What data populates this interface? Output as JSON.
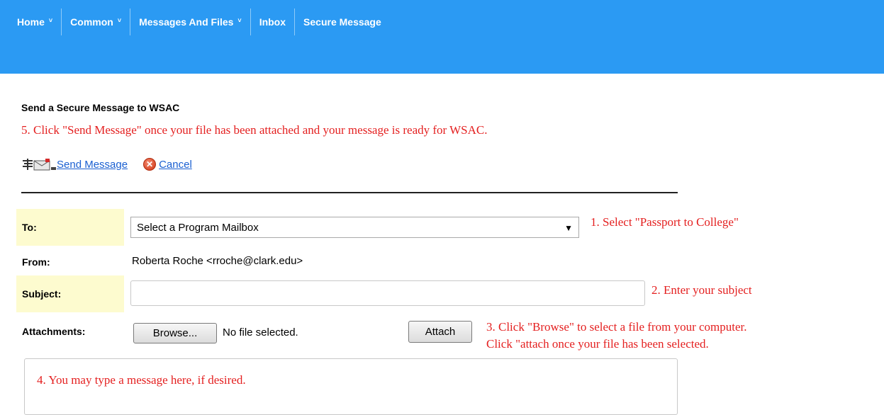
{
  "nav": {
    "items": [
      {
        "label": "Home",
        "has_dropdown": true
      },
      {
        "label": "Common",
        "has_dropdown": true
      },
      {
        "label": "Messages And Files",
        "has_dropdown": true
      },
      {
        "label": "Inbox",
        "has_dropdown": false
      },
      {
        "label": "Secure Message",
        "has_dropdown": false
      }
    ],
    "chevron": "˅"
  },
  "page": {
    "heading": "Send a Secure Message to WSAC"
  },
  "instructions": {
    "step5": "5.  Click \"Send Message\" once your file has been attached and your message is ready for WSAC.",
    "step1": "1. Select \"Passport to College\"",
    "step2": "2.  Enter your subject",
    "step3_line1": "3.  Click \"Browse\" to select a file from your computer.",
    "step3_line2": "Click \"attach once your file has been selected.",
    "step4": "4.  You may type a message here, if desired."
  },
  "actions": {
    "send_label": "Send Message",
    "cancel_label": "Cancel",
    "cancel_glyph": "✕"
  },
  "form": {
    "to_label": "To:",
    "to_value": "Select a Program Mailbox",
    "from_label": "From:",
    "from_value": "Roberta Roche <rroche@clark.edu>",
    "subject_label": "Subject:",
    "subject_value": "",
    "attachments_label": "Attachments:",
    "browse_label": "Browse...",
    "file_status": "No file selected.",
    "attach_label": "Attach",
    "dropdown_arrow": "▼"
  },
  "colors": {
    "nav_bg": "#2b9af3",
    "instruction_red": "#e41f1f",
    "link_blue": "#1a5fd1",
    "label_highlight": "#fdfbcf"
  }
}
